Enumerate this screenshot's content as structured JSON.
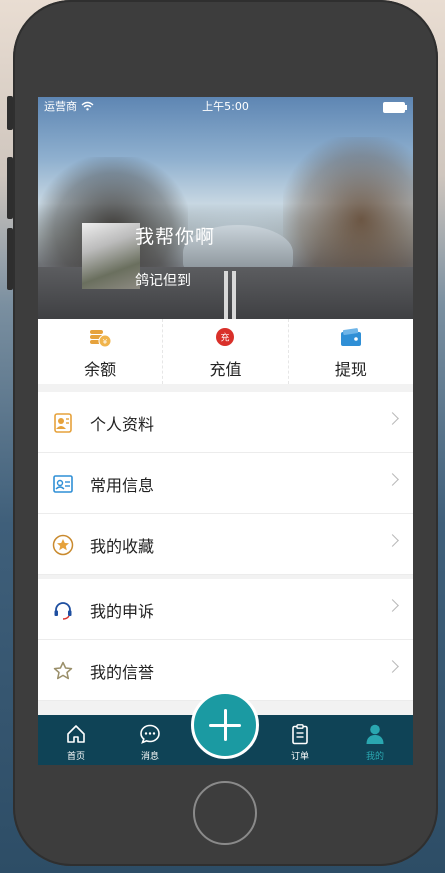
{
  "status_bar": {
    "carrier": "运营商",
    "time": "上午5:00"
  },
  "profile": {
    "name": "我帮你啊",
    "signature": "鸽记但到"
  },
  "wallet": [
    {
      "label": "余额",
      "icon": "coin-stack-icon",
      "color": "#e6a23c"
    },
    {
      "label": "充值",
      "icon": "recharge-badge-icon",
      "badge": "充",
      "color": "#d9302a"
    },
    {
      "label": "提现",
      "icon": "wallet-icon",
      "color": "#2f8fd6"
    }
  ],
  "menu": [
    {
      "label": "个人资料",
      "icon": "profile-card-icon",
      "color": "#e6a23c"
    },
    {
      "label": "常用信息",
      "icon": "contact-card-icon",
      "color": "#2f8fd6"
    },
    {
      "label": "我的收藏",
      "icon": "star-circle-icon",
      "color": "#c98a2e"
    },
    {
      "label": "我的申诉",
      "icon": "headset-icon",
      "color": "#1f4fa0"
    },
    {
      "label": "我的信誉",
      "icon": "star-outline-icon",
      "color": "#9a8f6a"
    }
  ],
  "tabbar": [
    {
      "label": "首页",
      "icon": "home-icon"
    },
    {
      "label": "消息",
      "icon": "chat-bubble-icon"
    },
    {
      "label": "订单",
      "icon": "clipboard-icon"
    },
    {
      "label": "我的",
      "icon": "person-icon",
      "active": true
    }
  ],
  "colors": {
    "tabbar_bg": "#0f4356",
    "accent": "#1b9aa2",
    "active_tab": "#2aa7b0"
  }
}
